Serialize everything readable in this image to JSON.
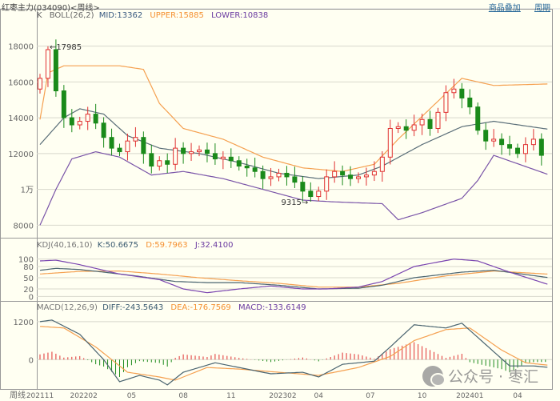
{
  "window": {
    "title": "红枣主力(034090)<周线>",
    "links": [
      "商品叠加",
      "周期"
    ]
  },
  "main_header": {
    "k": "K",
    "boll": "BOLL(26,2)",
    "mid": "MID:13362",
    "upper": "UPPER:15885",
    "lower": "LOWER:10838"
  },
  "kdj_header": {
    "name": "KDJ(40,16,10)",
    "k": "K:50.6675",
    "d": "D:59.7963",
    "j": "J:32.4100"
  },
  "macd_header": {
    "name": "MACD(12,26,9)",
    "diff": "DIFF:-243.5643",
    "dea": "DEA:-176.7569",
    "macd": "MACD:-133.6149"
  },
  "annotations": {
    "high": "17985",
    "low": "9315"
  },
  "watermark": "公众号 · 枣汇",
  "colors": {
    "up": "#e03030",
    "down": "#1a8a1a",
    "mid": "#5a6e78",
    "upper": "#f5a050",
    "lower": "#7a55a8",
    "k": "#4a6470",
    "d": "#f5a050",
    "j": "#7a45b0",
    "bg": "#fffff2"
  },
  "chart_data": [
    {
      "type": "candlestick",
      "title": "K BOLL(26,2)",
      "period_label": "周线",
      "x_ticks": [
        "202111",
        "202202",
        "05",
        "08",
        "11",
        "202302",
        "04",
        "07",
        "10",
        "202401",
        "04"
      ],
      "x_tick_index": [
        0,
        5.5,
        11.5,
        18,
        24,
        30.5,
        35,
        41.5,
        48,
        54,
        60
      ],
      "y_ticks": [
        {
          "v": 18000,
          "label": "18000"
        },
        {
          "v": 16000,
          "label": "16000"
        },
        {
          "v": 14000,
          "label": "14000"
        },
        {
          "v": 12000,
          "label": "12000"
        },
        {
          "v": 10000,
          "label": "1万"
        },
        {
          "v": 8000,
          "label": "8000"
        }
      ],
      "ylim": [
        7300,
        19500
      ],
      "closes": [
        16200,
        17800,
        15500,
        14000,
        13600,
        13800,
        14200,
        13700,
        12900,
        12300,
        12100,
        12700,
        12900,
        12000,
        11300,
        11600,
        11400,
        12300,
        12000,
        12100,
        12200,
        12000,
        11700,
        11800,
        11600,
        11300,
        11200,
        11000,
        10600,
        10700,
        10900,
        10700,
        10400,
        9900,
        9600,
        9900,
        10700,
        11000,
        10800,
        10600,
        10700,
        10800,
        11000,
        11800,
        13400,
        13500,
        13300,
        13600,
        13900,
        13400,
        14300,
        15400,
        15600,
        15100,
        14600,
        13300,
        12700,
        12800,
        12500,
        12300,
        12000,
        12500,
        12800,
        11900
      ],
      "first_open": 15600,
      "high_point": {
        "index": 1,
        "value": 17985
      },
      "low_point": {
        "index": 34,
        "value": 9315
      },
      "boll_mid": [
        [
          0,
          12500
        ],
        [
          3,
          14000
        ],
        [
          5,
          14500
        ],
        [
          8,
          14200
        ],
        [
          11,
          13000
        ],
        [
          15,
          12300
        ],
        [
          20,
          12000
        ],
        [
          25,
          11500
        ],
        [
          30,
          10900
        ],
        [
          35,
          10600
        ],
        [
          40,
          10800
        ],
        [
          43,
          11300
        ],
        [
          48,
          12500
        ],
        [
          53,
          13500
        ],
        [
          57,
          13800
        ],
        [
          63.8,
          13362
        ]
      ],
      "boll_upper": [
        [
          0,
          13900
        ],
        [
          1,
          16500
        ],
        [
          3,
          16900
        ],
        [
          7,
          16900
        ],
        [
          10,
          16900
        ],
        [
          13,
          16700
        ],
        [
          15,
          14800
        ],
        [
          18,
          13400
        ],
        [
          23,
          12800
        ],
        [
          28,
          11800
        ],
        [
          33,
          11200
        ],
        [
          38,
          11000
        ],
        [
          42,
          11400
        ],
        [
          45,
          12800
        ],
        [
          49,
          14500
        ],
        [
          53,
          16200
        ],
        [
          57,
          15800
        ],
        [
          63.8,
          15885
        ]
      ],
      "boll_lower": [
        [
          0,
          8000
        ],
        [
          2,
          10000
        ],
        [
          4,
          11700
        ],
        [
          7,
          12100
        ],
        [
          10,
          11800
        ],
        [
          14,
          10800
        ],
        [
          18,
          11000
        ],
        [
          23,
          10600
        ],
        [
          28,
          10000
        ],
        [
          33,
          9400
        ],
        [
          37,
          9300
        ],
        [
          43,
          9200
        ],
        [
          45,
          8300
        ],
        [
          48,
          8700
        ],
        [
          53,
          9500
        ],
        [
          55,
          10500
        ],
        [
          57,
          11900
        ],
        [
          63.8,
          10838
        ]
      ]
    },
    {
      "type": "line",
      "title": "KDJ(40,16,10)",
      "y_ticks": [
        {
          "v": 100,
          "label": "100"
        },
        {
          "v": 80,
          "label": "80"
        },
        {
          "v": 50,
          "label": "50"
        },
        {
          "v": 20,
          "label": "20"
        },
        {
          "v": 0,
          "label": "0"
        }
      ],
      "ylim": [
        -10,
        125
      ],
      "K": [
        [
          0,
          70
        ],
        [
          2,
          75
        ],
        [
          5,
          72
        ],
        [
          8,
          65
        ],
        [
          12,
          55
        ],
        [
          17,
          40
        ],
        [
          21,
          37
        ],
        [
          25,
          37
        ],
        [
          30,
          30
        ],
        [
          35,
          20
        ],
        [
          40,
          22
        ],
        [
          43,
          30
        ],
        [
          47,
          50
        ],
        [
          53,
          65
        ],
        [
          57,
          70
        ],
        [
          63.8,
          50.67
        ]
      ],
      "D": [
        [
          0,
          60
        ],
        [
          5,
          67
        ],
        [
          10,
          68
        ],
        [
          15,
          60
        ],
        [
          20,
          50
        ],
        [
          25,
          42
        ],
        [
          30,
          35
        ],
        [
          35,
          25
        ],
        [
          40,
          25
        ],
        [
          45,
          35
        ],
        [
          51,
          55
        ],
        [
          57,
          68
        ],
        [
          63.8,
          59.8
        ]
      ],
      "J": [
        [
          0,
          95
        ],
        [
          2,
          97
        ],
        [
          5,
          85
        ],
        [
          10,
          60
        ],
        [
          15,
          45
        ],
        [
          18,
          20
        ],
        [
          21,
          10
        ],
        [
          25,
          20
        ],
        [
          29,
          28
        ],
        [
          33,
          20
        ],
        [
          36,
          20
        ],
        [
          40,
          25
        ],
        [
          43,
          40
        ],
        [
          47,
          80
        ],
        [
          52,
          100
        ],
        [
          55,
          95
        ],
        [
          59,
          65
        ],
        [
          63.8,
          32.41
        ]
      ]
    },
    {
      "type": "bar+line",
      "title": "MACD(12,26,9)",
      "y_ticks": [
        {
          "v": 1200,
          "label": "1200"
        },
        {
          "v": 0,
          "label": "0"
        }
      ],
      "ylim": [
        -930,
        1500
      ],
      "DIFF": [
        [
          0,
          1200
        ],
        [
          1.5,
          1250
        ],
        [
          5,
          800
        ],
        [
          8,
          0
        ],
        [
          10,
          -700
        ],
        [
          12.5,
          -500
        ],
        [
          15,
          -650
        ],
        [
          16,
          -800
        ],
        [
          18,
          -400
        ],
        [
          22,
          -100
        ],
        [
          25,
          -250
        ],
        [
          29,
          -450
        ],
        [
          33,
          -400
        ],
        [
          35,
          -550
        ],
        [
          38,
          -150
        ],
        [
          42,
          -50
        ],
        [
          44,
          400
        ],
        [
          47,
          1100
        ],
        [
          51,
          1000
        ],
        [
          53,
          1150
        ],
        [
          55,
          700
        ],
        [
          59,
          -200
        ],
        [
          62,
          -200
        ],
        [
          63.8,
          -243.56
        ]
      ],
      "DEA": [
        [
          0,
          1050
        ],
        [
          3,
          1000
        ],
        [
          7,
          400
        ],
        [
          11,
          -400
        ],
        [
          15,
          -550
        ],
        [
          17,
          -650
        ],
        [
          21,
          -250
        ],
        [
          25,
          -300
        ],
        [
          30,
          -400
        ],
        [
          35,
          -500
        ],
        [
          40,
          -250
        ],
        [
          44,
          100
        ],
        [
          47,
          600
        ],
        [
          51,
          950
        ],
        [
          54,
          1000
        ],
        [
          58,
          300
        ],
        [
          61,
          -100
        ],
        [
          63.8,
          -176.76
        ]
      ]
    }
  ]
}
